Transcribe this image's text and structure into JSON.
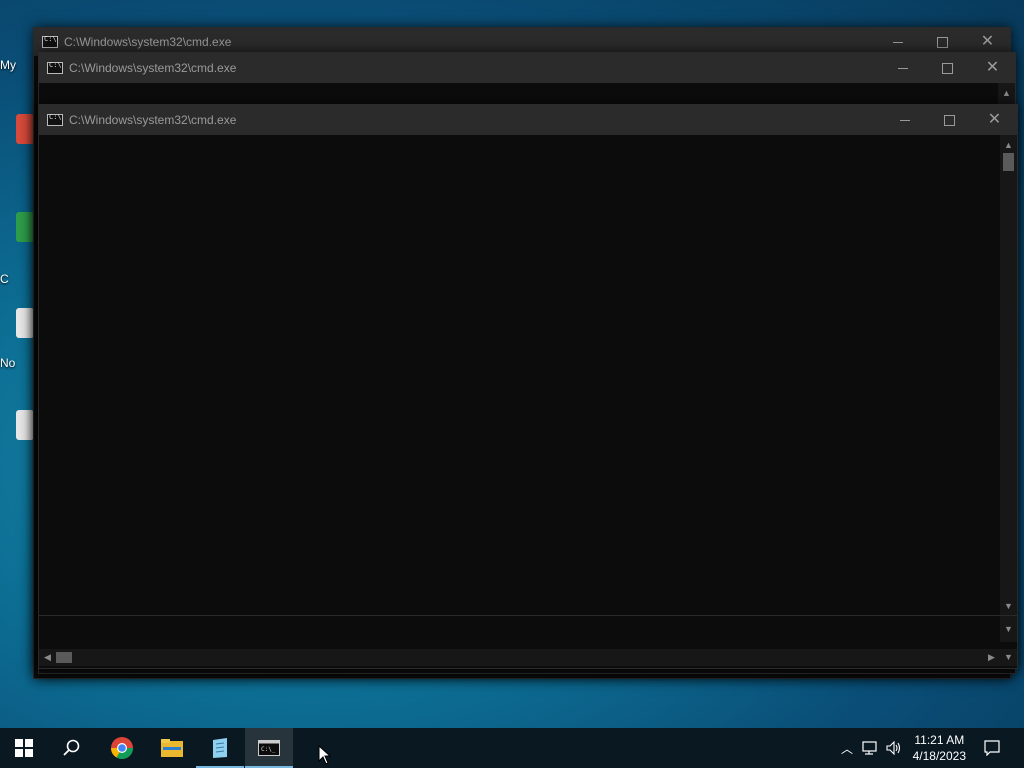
{
  "desktop": {
    "icons": [
      {
        "label": "My",
        "icon": "computer-icon"
      },
      {
        "label": "",
        "icon": "chrome-shortcut-icon"
      },
      {
        "label": "C",
        "icon": "chrome-icon"
      },
      {
        "label": "No",
        "icon": "notepad-icon"
      },
      {
        "label": "",
        "icon": "file-icon"
      }
    ]
  },
  "windows": [
    {
      "title": "C:\\Windows\\system32\\cmd.exe"
    },
    {
      "title": "C:\\Windows\\system32\\cmd.exe"
    },
    {
      "title": "C:\\Windows\\system32\\cmd.exe"
    }
  ],
  "taskbar": {
    "items": [
      "start-icon",
      "search-icon",
      "chrome-icon",
      "file-explorer-icon",
      "notepad-icon",
      "cmd-icon"
    ],
    "active": "cmd-icon"
  },
  "tray": {
    "time": "11:21 AM",
    "date": "4/18/2023",
    "icons": [
      "chevron-up-icon",
      "network-icon",
      "volume-icon",
      "notifications-icon"
    ]
  },
  "colors": {
    "console_bg": "#0c0c0c",
    "titlebar_bg": "#2b2b2b",
    "taskbar_bg": "#0a1822",
    "accent": "#77b7e0"
  }
}
